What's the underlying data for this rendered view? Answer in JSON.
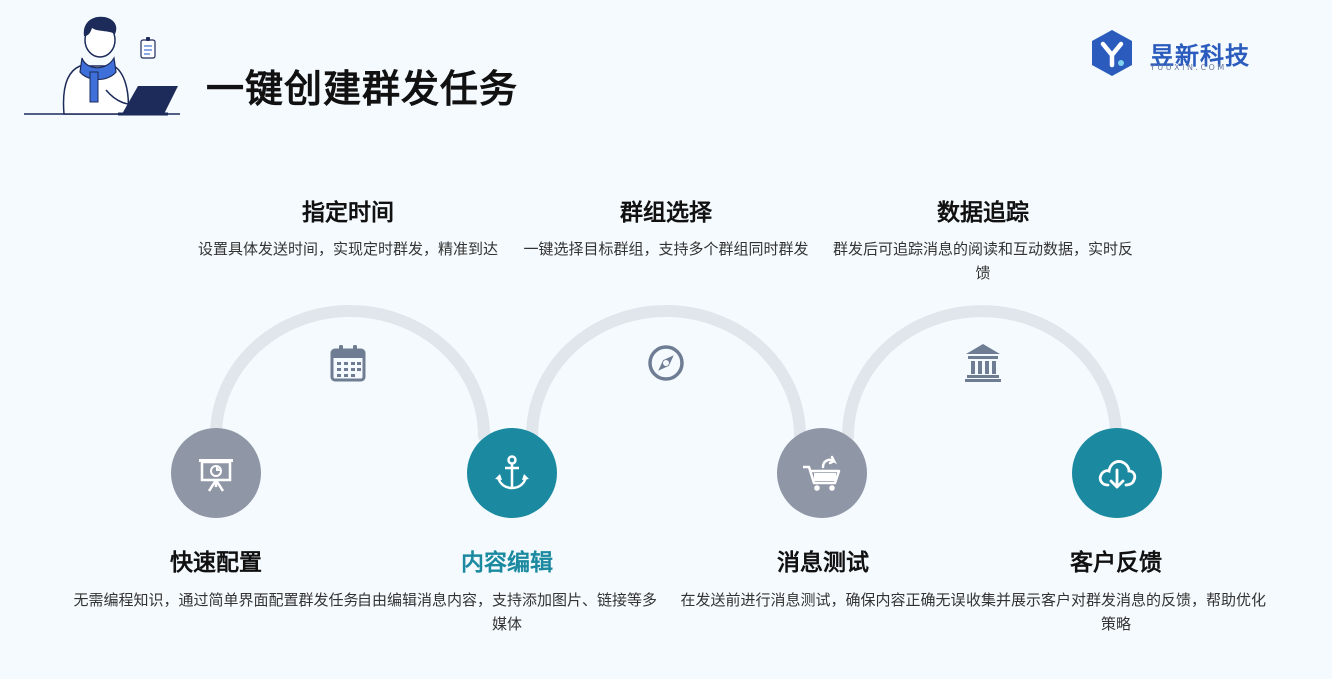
{
  "title": "一键创建群发任务",
  "logo": {
    "name": "昱新科技",
    "sub": "YUUXIN.COM"
  },
  "top_steps": [
    {
      "title": "指定时间",
      "desc": "设置具体发送时间，实现定时群发，精准到达",
      "icon": "calendar-icon"
    },
    {
      "title": "群组选择",
      "desc": "一键选择目标群组，支持多个群组同时群发",
      "icon": "compass-icon"
    },
    {
      "title": "数据追踪",
      "desc": "群发后可追踪消息的阅读和互动数据，实时反馈",
      "icon": "bank-icon"
    }
  ],
  "bottom_steps": [
    {
      "title": "快速配置",
      "desc": "无需编程知识，通过简单界面配置群发任务",
      "icon": "presentation-icon",
      "color": "#8f97a7"
    },
    {
      "title": "内容编辑",
      "desc": "自由编辑消息内容，支持添加图片、链接等多媒体",
      "icon": "anchor-icon",
      "color": "#1b8aa0"
    },
    {
      "title": "消息测试",
      "desc": "在发送前进行消息测试，确保内容正确无误",
      "icon": "cart-icon",
      "color": "#8f97a7"
    },
    {
      "title": "客户反馈",
      "desc": "收集并展示客户对群发消息的反馈，帮助优化策略",
      "icon": "download-cloud-icon",
      "color": "#1b8aa0"
    }
  ],
  "colors": {
    "accent": "#1b8aa0",
    "grey": "#8f97a7",
    "arc": "#e1e6ec",
    "brand": "#2a5bbd"
  }
}
